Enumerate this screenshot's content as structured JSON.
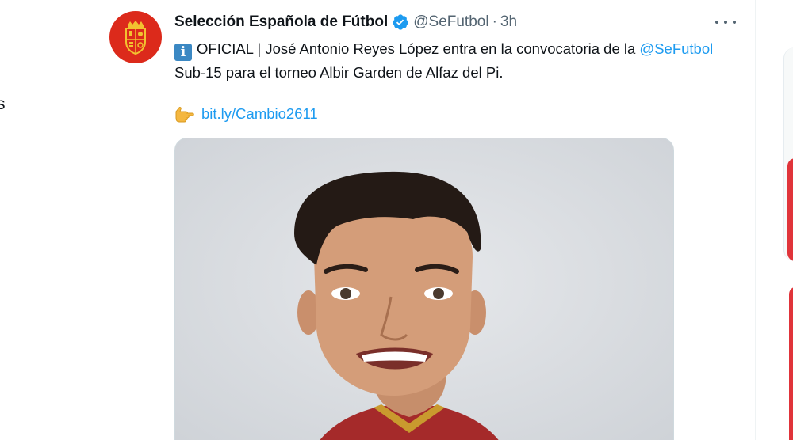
{
  "sidebar": {
    "fragment_text": "s"
  },
  "tweet": {
    "display_name": "Selección Española de Fútbol",
    "verified_icon": "verified-badge-icon",
    "handle": "@SeFutbol",
    "separator": "·",
    "timestamp": "3h",
    "more_icon": "more-options-icon",
    "text_part1": "OFICIAL | José Antonio Reyes López entra en la convocatoria de la ",
    "mention": "@SeFutbol",
    "text_part2": " Sub-15 para el torneo Albir Garden de Alfaz del Pi.",
    "link_emoji": "pointing-hand-icon",
    "link": "bit.ly/Cambio2611",
    "info_emoji_letter": "i"
  },
  "colors": {
    "brand_red": "#dc2a1b",
    "link_blue": "#1d9bf0",
    "muted": "#536471",
    "verified_blue": "#1d9bf0"
  }
}
